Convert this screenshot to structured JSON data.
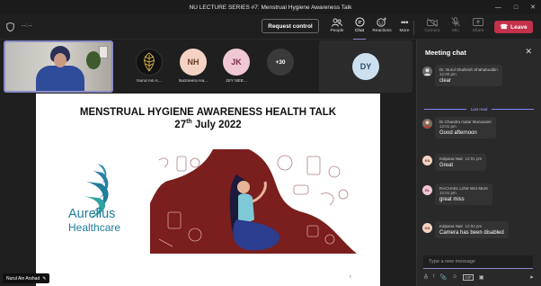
{
  "window": {
    "title": "NU LECTURE SERIES #7: Menstrual Hygiene Awareness Talk"
  },
  "toolbar": {
    "timer": "--:--",
    "request_control": "Request control",
    "items": [
      {
        "label": "People",
        "icon": "people-icon"
      },
      {
        "label": "Chat",
        "icon": "chat-icon"
      },
      {
        "label": "Reactions",
        "icon": "reactions-icon"
      },
      {
        "label": "More",
        "icon": "more-icon"
      },
      {
        "label": "Camera",
        "icon": "camera-icon"
      },
      {
        "label": "Mic",
        "icon": "mic-icon"
      },
      {
        "label": "Share",
        "icon": "share-icon"
      }
    ],
    "leave": "Leave"
  },
  "participants": [
    {
      "initials": "",
      "name": "Nurul Ain A..."
    },
    {
      "initials": "NH",
      "name": "Nazneera Ha..."
    },
    {
      "initials": "JK",
      "name": "JEY NEE..."
    },
    {
      "initials": "+30",
      "name": ""
    },
    {
      "initials": "DY",
      "name": ""
    }
  ],
  "slide": {
    "title": "MENSTRUAL HYGIENE AWARENESS HEALTH TALK",
    "date_day": "27",
    "date_suffix": "th",
    "date_rest": " July 2022",
    "logo_line1": "Aurelius",
    "logo_line2": "Healthcare",
    "page_number": "2"
  },
  "speaker": "Nurul Ain Arshad",
  "chat": {
    "header": "Meeting chat",
    "last_read": "Last read",
    "compose_placeholder": "Type a new message",
    "messages": [
      {
        "initials": "",
        "sender": "Dr. Nurul Shahirah Shahabuddin",
        "time": "12:00 pm",
        "text": "clear"
      },
      {
        "initials": "",
        "sender": "Dr.Chandra malar Munusami",
        "time": "12:01 pm",
        "text": "Good afternoon"
      },
      {
        "initials": "KN",
        "sender": "Kalpana Nair",
        "time": "12:01 pm",
        "text": "Great"
      },
      {
        "initials": "RL",
        "sender": "RACHAEL LOW WAI MUN",
        "time": "12:01 pm",
        "text": "great miss"
      },
      {
        "initials": "KN",
        "sender": "Kalpana Nair",
        "time": "12:02 pm",
        "text": "Camera has been disabled"
      }
    ]
  }
}
